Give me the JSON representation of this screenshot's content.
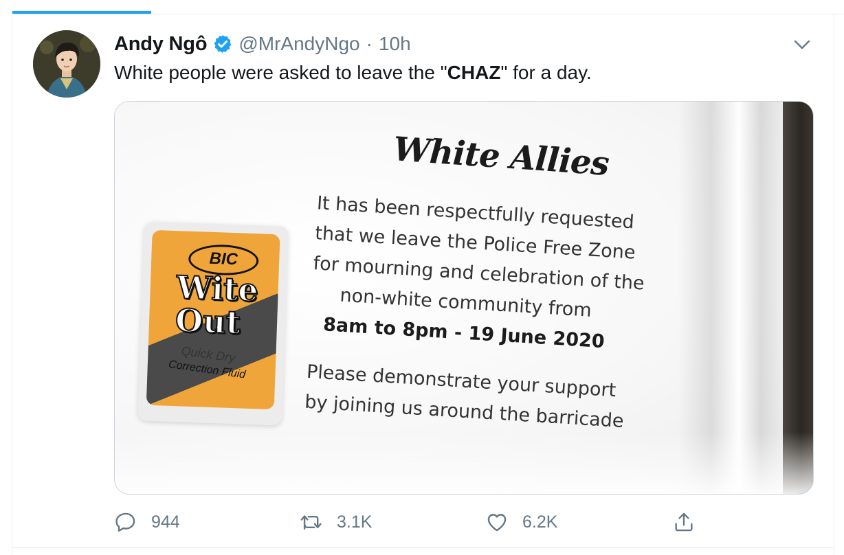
{
  "tweet": {
    "display_name": "Andy Ngô",
    "handle": "@MrAndyNgo",
    "separator": "·",
    "timestamp": "10h",
    "verified": true,
    "text_before": "White people were asked to leave the \"",
    "text_bold": "CHAZ",
    "text_after": "\" for a day."
  },
  "media": {
    "poster_title": "White Allies",
    "poster_lines": [
      "It has been respectfully requested",
      "that we leave the Police Free Zone",
      "for mourning and celebration of the",
      "non-white community from"
    ],
    "poster_time": "8am to 8pm - 19 June 2020",
    "poster_closing": [
      "Please demonstrate your support",
      "by joining us around the barricade"
    ],
    "bottle_brand": "BIC",
    "bottle_name_1": "Wite",
    "bottle_name_2": "Out",
    "bottle_sub_1": "Quick Dry",
    "bottle_sub_2": "Correction Fluid"
  },
  "actions": {
    "reply_count": "944",
    "retweet_count": "3.1K",
    "like_count": "6.2K"
  },
  "colors": {
    "accent": "#1da1f2",
    "secondary_text": "#657786",
    "border": "#e6ecf0"
  },
  "icons": {
    "verified": "verified-badge-icon",
    "menu": "chevron-down-icon",
    "reply": "reply-icon",
    "retweet": "retweet-icon",
    "like": "heart-icon",
    "share": "share-icon"
  }
}
